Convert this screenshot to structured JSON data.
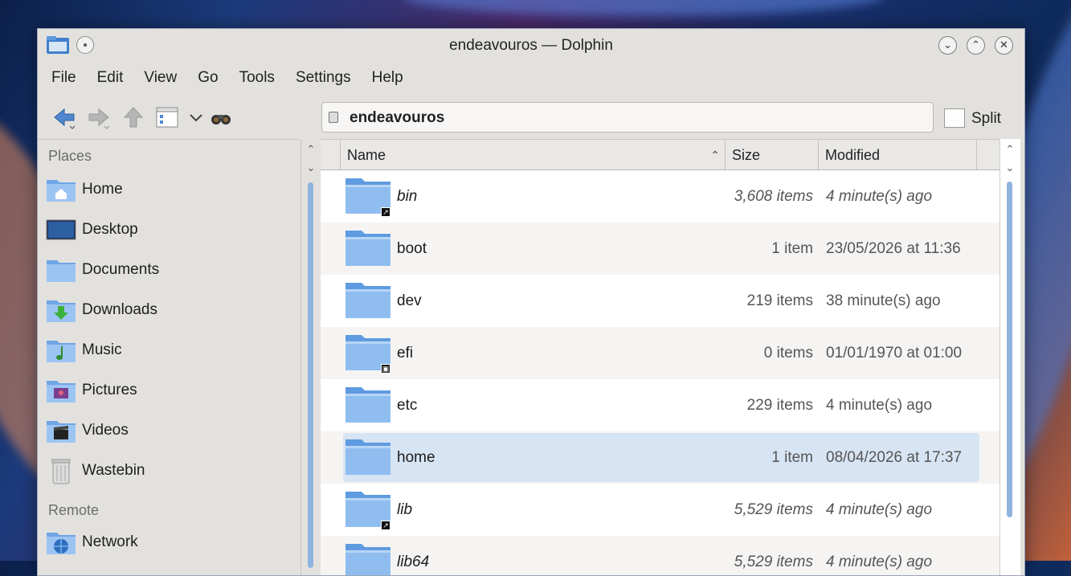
{
  "window": {
    "title": "endeavouros — Dolphin"
  },
  "menu": [
    "File",
    "Edit",
    "View",
    "Go",
    "Tools",
    "Settings",
    "Help"
  ],
  "location": {
    "path": "endeavouros"
  },
  "toolbar": {
    "split_label": "Split"
  },
  "places": {
    "section_places": "Places",
    "section_remote": "Remote",
    "items": [
      {
        "label": "Home",
        "icon": "home-folder-icon"
      },
      {
        "label": "Desktop",
        "icon": "desktop-icon"
      },
      {
        "label": "Documents",
        "icon": "documents-folder-icon"
      },
      {
        "label": "Downloads",
        "icon": "downloads-folder-icon"
      },
      {
        "label": "Music",
        "icon": "music-folder-icon"
      },
      {
        "label": "Pictures",
        "icon": "pictures-folder-icon"
      },
      {
        "label": "Videos",
        "icon": "videos-folder-icon"
      },
      {
        "label": "Wastebin",
        "icon": "wastebin-icon"
      }
    ],
    "remote_items": [
      {
        "label": "Network",
        "icon": "network-icon"
      }
    ]
  },
  "columns": {
    "name": "Name",
    "size": "Size",
    "modified": "Modified"
  },
  "files": [
    {
      "name": "bin",
      "size": "3,608 items",
      "modified": "4 minute(s) ago",
      "symlink": true,
      "emblem": "link"
    },
    {
      "name": "boot",
      "size": "1 item",
      "modified": "23/05/2026 at 11:36",
      "symlink": false
    },
    {
      "name": "dev",
      "size": "219 items",
      "modified": "38 minute(s) ago",
      "symlink": false
    },
    {
      "name": "efi",
      "size": "0 items",
      "modified": "01/01/1970 at 01:00",
      "symlink": false,
      "emblem": "lock"
    },
    {
      "name": "etc",
      "size": "229 items",
      "modified": "4 minute(s) ago",
      "symlink": false
    },
    {
      "name": "home",
      "size": "1 item",
      "modified": "08/04/2026 at 17:37",
      "symlink": false,
      "selected": true
    },
    {
      "name": "lib",
      "size": "5,529 items",
      "modified": "4 minute(s) ago",
      "symlink": true,
      "emblem": "link"
    },
    {
      "name": "lib64",
      "size": "5,529 items",
      "modified": "4 minute(s) ago",
      "symlink": true,
      "emblem": "link"
    }
  ],
  "colors": {
    "selection": "#d7e4f3",
    "folder": "#6fa6e6",
    "scrollbar": "#8fb3df"
  }
}
